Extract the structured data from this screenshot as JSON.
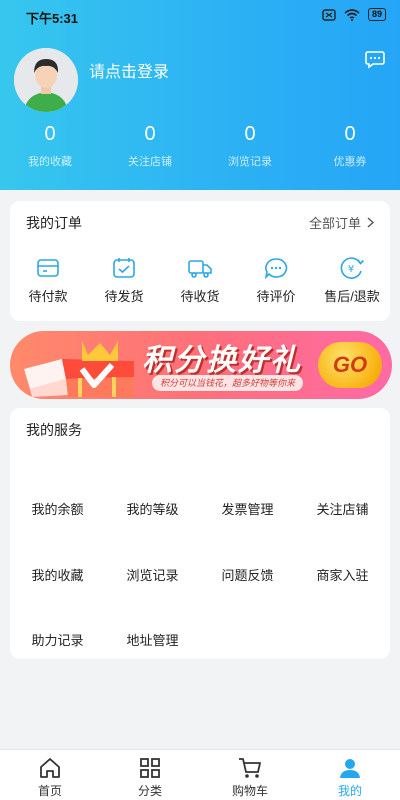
{
  "status_bar": {
    "time": "下午5:31",
    "battery": "89"
  },
  "profile": {
    "login_prompt": "请点击登录"
  },
  "stats": [
    {
      "value": "0",
      "label": "我的收藏"
    },
    {
      "value": "0",
      "label": "关注店铺"
    },
    {
      "value": "0",
      "label": "浏览记录"
    },
    {
      "value": "0",
      "label": "优惠券"
    }
  ],
  "orders": {
    "title": "我的订单",
    "all_label": "全部订单",
    "items": [
      {
        "label": "待付款",
        "icon": "wallet-icon"
      },
      {
        "label": "待发货",
        "icon": "package-icon"
      },
      {
        "label": "待收货",
        "icon": "truck-icon"
      },
      {
        "label": "待评价",
        "icon": "comment-icon"
      },
      {
        "label": "售后/退款",
        "icon": "refund-icon"
      }
    ]
  },
  "banner": {
    "title": "积分换好礼",
    "subtitle": "积分可以当钱花，超多好物等你来",
    "button": "GO"
  },
  "services": {
    "title": "我的服务",
    "items": [
      "我的余额",
      "我的等级",
      "发票管理",
      "关注店铺",
      "我的收藏",
      "浏览记录",
      "问题反馈",
      "商家入驻",
      "助力记录",
      "地址管理"
    ]
  },
  "tabbar": {
    "items": [
      {
        "label": "首页",
        "icon": "home-icon"
      },
      {
        "label": "分类",
        "icon": "grid-icon"
      },
      {
        "label": "购物车",
        "icon": "cart-icon"
      },
      {
        "label": "我的",
        "icon": "user-icon",
        "active": true
      }
    ]
  },
  "colors": {
    "accent": "#24a7ef",
    "header_start": "#36c7ee",
    "header_end": "#25a5f6"
  }
}
